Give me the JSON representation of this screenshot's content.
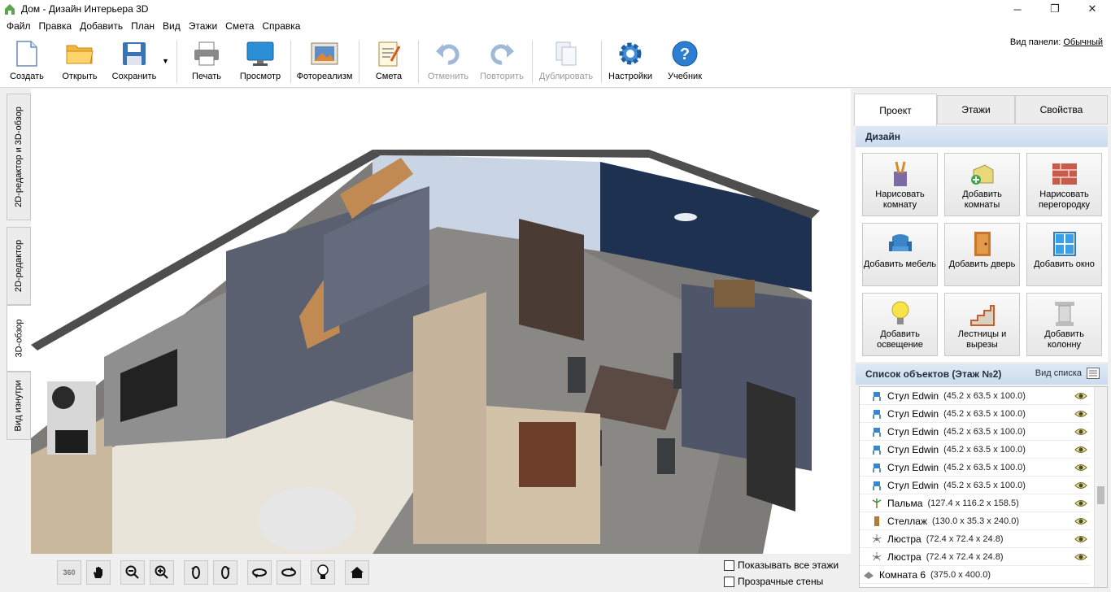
{
  "window": {
    "title": "Дом - Дизайн Интерьера 3D",
    "buttons": [
      "─",
      "❐",
      "✕"
    ]
  },
  "menu": [
    "Файл",
    "Правка",
    "Добавить",
    "План",
    "Вид",
    "Этажи",
    "Смета",
    "Справка"
  ],
  "toolbar": {
    "buttons": [
      {
        "label": "Создать",
        "icon": "new-file-icon",
        "enabled": true
      },
      {
        "label": "Открыть",
        "icon": "folder-icon",
        "enabled": true
      },
      {
        "label": "Сохранить",
        "icon": "floppy-icon",
        "enabled": true
      },
      {
        "label": "Печать",
        "icon": "printer-icon",
        "enabled": true
      },
      {
        "label": "Просмотр",
        "icon": "monitor-icon",
        "enabled": true
      },
      {
        "label": "Фотореализм",
        "icon": "photo-icon",
        "enabled": true
      },
      {
        "label": "Смета",
        "icon": "notepad-icon",
        "enabled": true
      },
      {
        "label": "Отменить",
        "icon": "undo-icon",
        "enabled": false
      },
      {
        "label": "Повторить",
        "icon": "redo-icon",
        "enabled": false
      },
      {
        "label": "Дублировать",
        "icon": "duplicate-icon",
        "enabled": false
      },
      {
        "label": "Настройки",
        "icon": "gear-icon",
        "enabled": true
      },
      {
        "label": "Учебник",
        "icon": "help-icon",
        "enabled": true
      }
    ],
    "panel_view_label": "Вид панели:",
    "panel_view_value": "Обычный"
  },
  "left_tabs": [
    "2D-редактор и 3D-обзор",
    "2D-редактор",
    "3D-обзор",
    "Вид изнутри"
  ],
  "left_tabs_active": "3D-обзор",
  "viewport_controls": [
    "360",
    "hand",
    "zoom-out",
    "zoom-in",
    "rotate-left",
    "rotate-right",
    "tilt-down",
    "tilt-up",
    "light",
    "home"
  ],
  "viewport_icons": [
    "rotate-360-icon",
    "hand-icon",
    "zoom-out-icon",
    "zoom-in-icon",
    "orbit-left-icon",
    "orbit-right-icon",
    "tilt-down-icon",
    "tilt-up-icon",
    "lightbulb-icon",
    "home-icon"
  ],
  "options": {
    "show_all_floors": "Показывать все этажи",
    "transparent_walls": "Прозрачные стены"
  },
  "right_tabs": [
    "Проект",
    "Этажи",
    "Свойства"
  ],
  "design": {
    "header": "Дизайн",
    "buttons": [
      {
        "label": "Нарисовать комнату",
        "icon": "draw-room-icon"
      },
      {
        "label": "Добавить комнаты",
        "icon": "add-room-icon"
      },
      {
        "label": "Нарисовать перегородку",
        "icon": "brick-wall-icon"
      },
      {
        "label": "Добавить мебель",
        "icon": "armchair-icon"
      },
      {
        "label": "Добавить дверь",
        "icon": "door-icon"
      },
      {
        "label": "Добавить окно",
        "icon": "window-icon"
      },
      {
        "label": "Добавить освещение",
        "icon": "bulb-icon"
      },
      {
        "label": "Лестницы и вырезы",
        "icon": "stairs-icon"
      },
      {
        "label": "Добавить колонну",
        "icon": "column-icon"
      }
    ]
  },
  "object_list": {
    "header": "Список объектов (Этаж №2)",
    "view_label": "Вид списка",
    "items": [
      {
        "name": "Стул Edwin",
        "dims": "(45.2 x 63.5 x 100.0)",
        "icon": "chair-icon"
      },
      {
        "name": "Стул Edwin",
        "dims": "(45.2 x 63.5 x 100.0)",
        "icon": "chair-icon"
      },
      {
        "name": "Стул Edwin",
        "dims": "(45.2 x 63.5 x 100.0)",
        "icon": "chair-icon"
      },
      {
        "name": "Стул Edwin",
        "dims": "(45.2 x 63.5 x 100.0)",
        "icon": "chair-icon"
      },
      {
        "name": "Стул Edwin",
        "dims": "(45.2 x 63.5 x 100.0)",
        "icon": "chair-icon"
      },
      {
        "name": "Стул Edwin",
        "dims": "(45.2 x 63.5 x 100.0)",
        "icon": "chair-icon"
      },
      {
        "name": "Пальма",
        "dims": "(127.4 x 116.2 x 158.5)",
        "icon": "palm-icon"
      },
      {
        "name": "Стеллаж",
        "dims": "(130.0 x 35.3 x 240.0)",
        "icon": "shelf-icon"
      },
      {
        "name": "Люстра",
        "dims": "(72.4 x 72.4 x 24.8)",
        "icon": "chandelier-icon"
      },
      {
        "name": "Люстра",
        "dims": "(72.4 x 72.4 x 24.8)",
        "icon": "chandelier-icon"
      },
      {
        "name": "Комната 6",
        "dims": "(375.0 x 400.0)",
        "icon": "room-icon"
      }
    ]
  }
}
